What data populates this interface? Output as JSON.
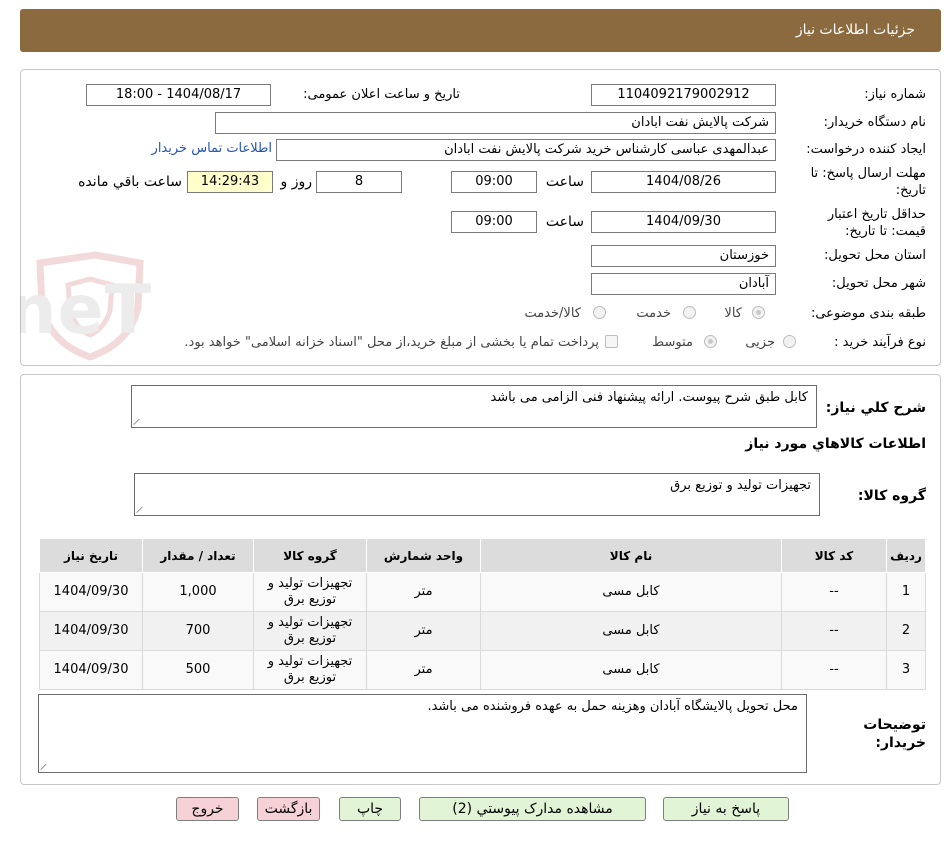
{
  "header": {
    "title": "جزئيات اطلاعات نياز"
  },
  "watermark": {
    "text": "AriaTender.neT"
  },
  "info": {
    "need_number_label": "شماره نیاز:",
    "need_number": "1104092179002912",
    "announce_label": "تاریخ و ساعت اعلان عمومی:",
    "announce_value": "1404/08/17 - 18:00",
    "buyer_label": "نام دستگاه خریدار:",
    "buyer_value": "شرکت پالایش نفت ابادان",
    "creator_label": "ایجاد کننده درخواست:",
    "creator_value": "عبدالمهدی  عباسی کارشناس خرید شرکت پالایش نفت ابادان",
    "contact_link": "اطلاعات تماس خریدار",
    "deadline_label": "مهلت ارسال پاسخ: تا تاریخ:",
    "deadline_date": "1404/08/26",
    "time_label": "ساعت",
    "deadline_time": "09:00",
    "days_value": "8",
    "days_label": "روز و",
    "remaining_time": "14:29:43",
    "remaining_label": "ساعت باقي مانده",
    "validity_label": "حداقل تاریخ اعتبار قیمت: تا تاریخ:",
    "validity_date": "1404/09/30",
    "validity_time": "09:00",
    "province_label": "استان محل تحویل:",
    "province_value": "خوزستان",
    "city_label": "شهر محل تحویل:",
    "city_value": "آبادان",
    "category_label": "طبقه بندی موضوعی:",
    "category_options": [
      "کالا",
      "خدمت",
      "کالا/خدمت"
    ],
    "category_selected": "کالا",
    "process_label": "نوع فرآیند خرید :",
    "process_options": [
      "جزیی",
      "متوسط"
    ],
    "process_selected": "متوسط",
    "treasury_note": "پرداخت تمام یا بخشی از مبلغ خرید،از محل \"اسناد خزانه اسلامی\" خواهد بود."
  },
  "details": {
    "general_desc_label": "شرح كلي نياز:",
    "general_desc": "کابل طبق شرح پیوست. ارائه پیشنهاد فنی الزامی می باشد",
    "goods_info_title": "اطلاعات کالاهاي مورد نياز",
    "goods_group_label": "گروه کالا:",
    "goods_group": "تجهیزات تولید و توزیع برق",
    "table": {
      "headers": [
        "رديف",
        "کد کالا",
        "نام کالا",
        "واحد شمارش",
        "گروه کالا",
        "تعداد / مقدار",
        "تاريخ نياز"
      ],
      "rows": [
        [
          "1",
          "--",
          "کابل مسی",
          "متر",
          "تجهیزات تولید و توزیع برق",
          "1,000",
          "1404/09/30"
        ],
        [
          "2",
          "--",
          "کابل مسی",
          "متر",
          "تجهیزات تولید و توزیع برق",
          "700",
          "1404/09/30"
        ],
        [
          "3",
          "--",
          "کابل مسی",
          "متر",
          "تجهیزات تولید و توزیع برق",
          "500",
          "1404/09/30"
        ]
      ]
    },
    "buyer_notes_label": "توضیحات خریدار:",
    "buyer_notes": "محل تحویل پالایشگاه آبادان وهزینه حمل به عهده فروشنده می باشد."
  },
  "buttons": {
    "reply": "پاسخ به نیاز",
    "attachments": "مشاهده مدارک پیوستي (2)",
    "print": "چاپ",
    "back": "بازگشت",
    "exit": "خروج"
  }
}
